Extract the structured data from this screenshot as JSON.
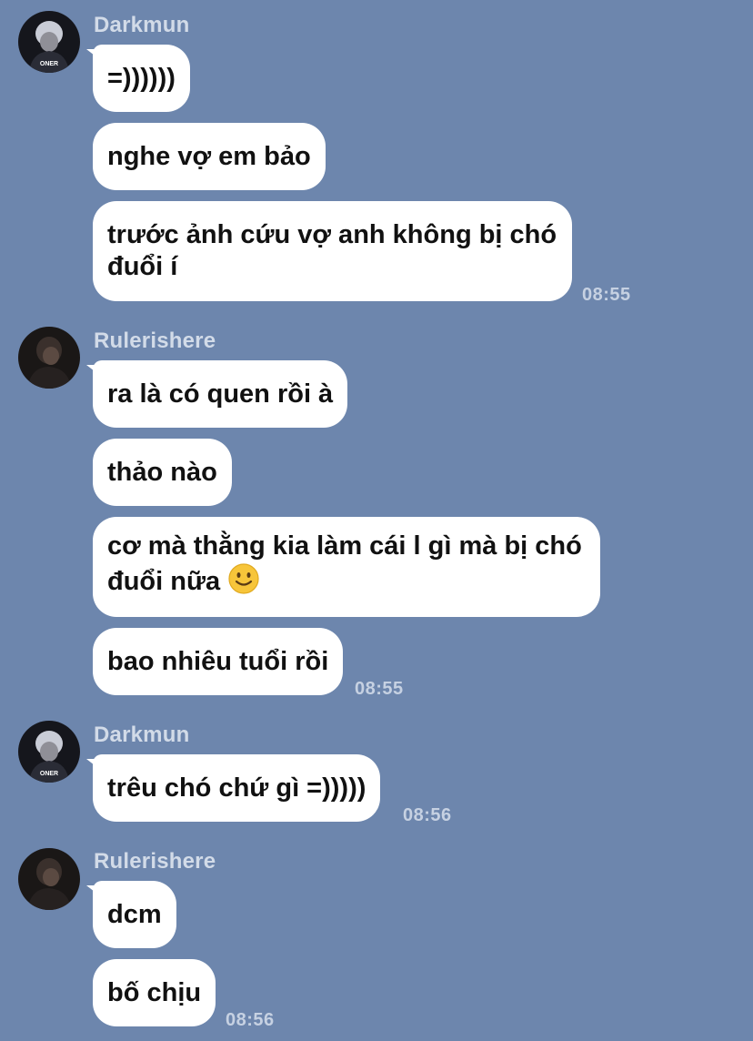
{
  "chat": {
    "groups": [
      {
        "sender": "Darkmun",
        "avatar_text": "ONER",
        "messages": [
          "=))))))",
          "nghe vợ em bảo",
          "trước ảnh cứu vợ anh không bị chó đuổi í"
        ],
        "time": "08:55"
      },
      {
        "sender": "Rulerishere",
        "messages": [
          "ra là có quen rồi à",
          "thảo nào",
          "cơ mà thằng kia làm cái l gì mà bị chó đuổi nữa",
          "bao nhiêu tuổi rồi"
        ],
        "time": "08:55"
      },
      {
        "sender": "Darkmun",
        "avatar_text": "ONER",
        "messages": [
          "trêu chó chứ gì =)))))"
        ],
        "time": "08:56"
      },
      {
        "sender": "Rulerishere",
        "messages": [
          "dcm",
          "bố chịu"
        ],
        "time": "08:56"
      }
    ],
    "emoji": "slightly-smiling-face-emoji"
  }
}
